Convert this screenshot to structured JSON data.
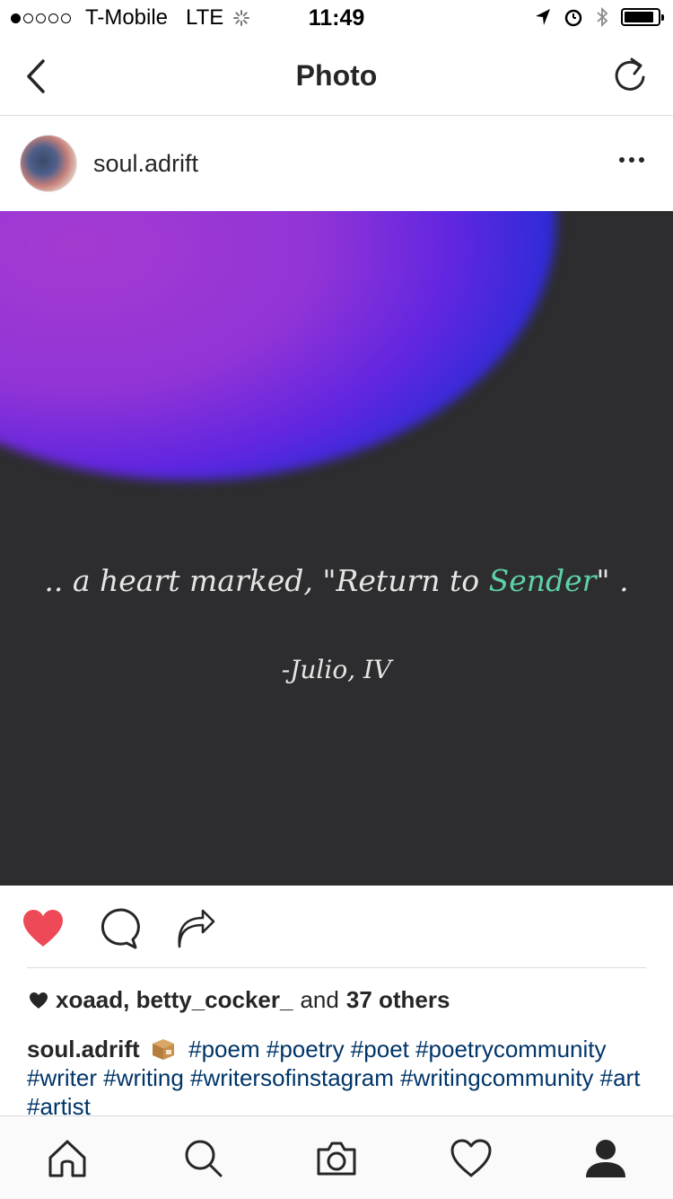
{
  "status_bar": {
    "carrier": "T-Mobile",
    "network": "LTE",
    "time": "11:49"
  },
  "nav": {
    "title": "Photo",
    "back_icon": "chevron-left-icon",
    "refresh_icon": "refresh-icon"
  },
  "post": {
    "username": "soul.adrift",
    "more_icon": "more-dots-icon",
    "image": {
      "quote_prefix": ".. a heart marked, \"Return to ",
      "quote_accent": "Sender",
      "quote_suffix": "\" .",
      "author": "-Julio, IV",
      "accent_color": "#5fd1a6"
    },
    "actions": {
      "like_icon": "heart-filled-icon",
      "comment_icon": "comment-icon",
      "share_icon": "share-icon",
      "like_color": "#ed4956"
    },
    "likes": {
      "users": "xoaad, betty_cocker_",
      "and_text": "and",
      "others": "37 others"
    },
    "caption": {
      "username": "soul.adrift",
      "hashtags": "#poem #poetry #poet #poetrycommunity #writer #writing #writersofinstagram #writingcommunity #art #artist"
    }
  },
  "tab_bar": {
    "items": [
      "home-icon",
      "search-icon",
      "camera-icon",
      "activity-heart-icon",
      "profile-icon"
    ]
  }
}
